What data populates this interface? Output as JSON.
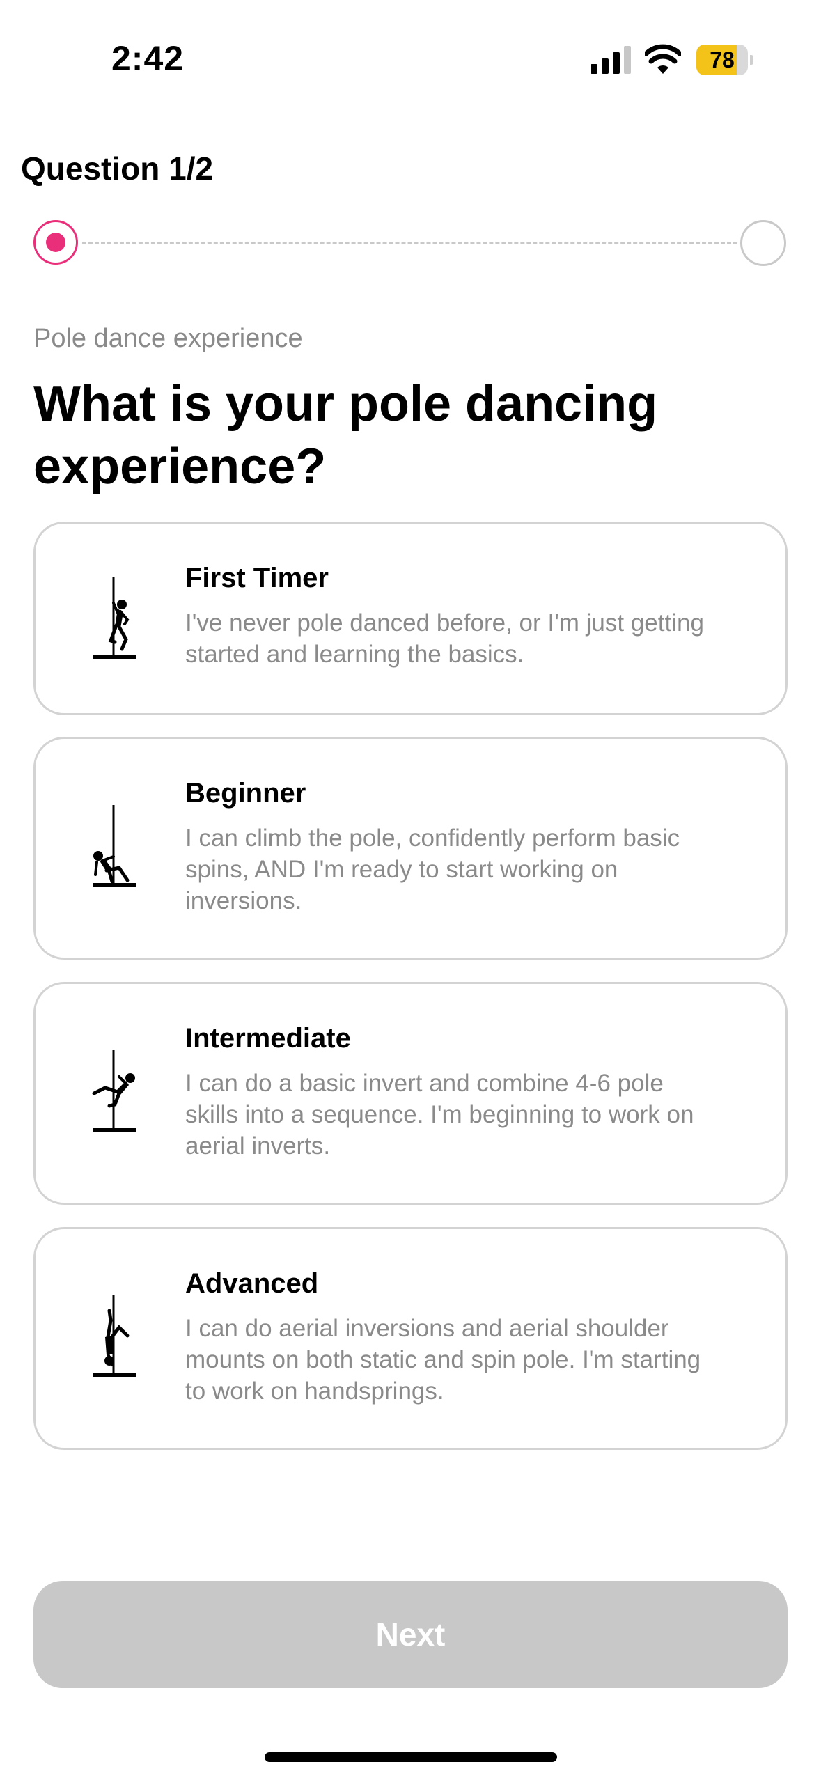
{
  "status_bar": {
    "time": "2:42",
    "battery_level": "78",
    "battery_fraction": 0.78,
    "signal_icon": "cellular-signal-icon",
    "wifi_icon": "wifi-icon",
    "battery_color": "#f4c31a"
  },
  "progress": {
    "label": "Question 1/2",
    "current_step": 1,
    "total_steps": 2,
    "accent_color": "#ea2f7a"
  },
  "question": {
    "category": "Pole dance experience",
    "title": "What is your pole dancing experience?"
  },
  "options": [
    {
      "title": "First Timer",
      "description": "I've never pole danced before, or I'm just getting started and learning the basics.",
      "icon": "pole-first-timer-icon"
    },
    {
      "title": "Beginner",
      "description": "I can climb the pole, confidently perform basic spins, AND I'm ready to start working on inversions.",
      "icon": "pole-beginner-icon"
    },
    {
      "title": "Intermediate",
      "description": "I can do a basic invert and combine 4-6 pole skills into a sequence. I'm beginning to work on aerial inverts.",
      "icon": "pole-intermediate-icon"
    },
    {
      "title": "Advanced",
      "description": "I can do aerial inversions and aerial shoulder mounts on both static and spin pole. I'm starting to work on handsprings.",
      "icon": "pole-advanced-icon"
    }
  ],
  "next_button": {
    "label": "Next",
    "enabled": false
  }
}
